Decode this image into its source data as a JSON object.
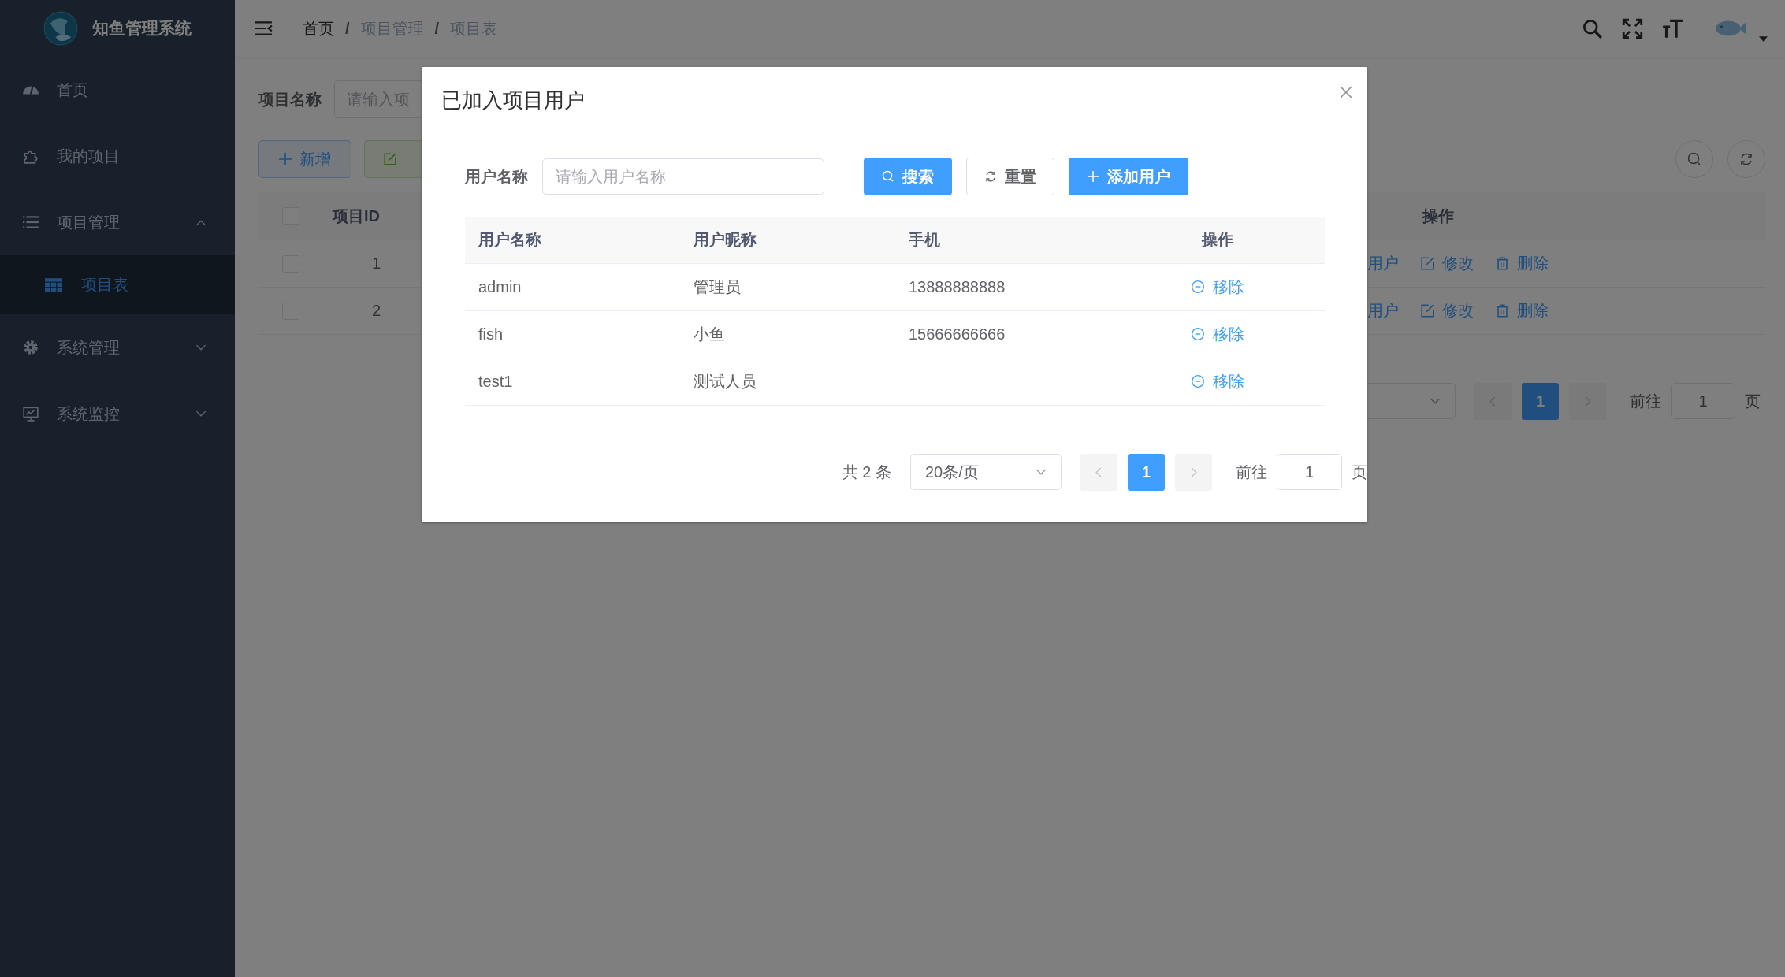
{
  "sidebar": {
    "title": "知鱼管理系统",
    "items": [
      {
        "label": "首页",
        "selected": false
      },
      {
        "label": "我的项目",
        "selected": false
      },
      {
        "label": "项目管理",
        "selected": false,
        "expanded": true,
        "children": [
          {
            "label": "项目表",
            "selected": true
          }
        ]
      },
      {
        "label": "系统管理",
        "selected": false,
        "expanded": false
      },
      {
        "label": "系统监控",
        "selected": false,
        "expanded": false
      }
    ]
  },
  "header": {
    "breadcrumb": [
      "首页",
      "项目管理",
      "项目表"
    ],
    "separator": "/"
  },
  "page": {
    "search_label": "项目名称",
    "search_placeholder": "请输入项",
    "add_button": "新增",
    "table": {
      "header_checked": false,
      "columns": [
        "项目ID",
        "操作"
      ],
      "rows": [
        {
          "id": "1",
          "checked": false,
          "actions": [
            {
              "kind": "text",
              "label": "用户"
            },
            {
              "kind": "edit",
              "label": "修改"
            },
            {
              "kind": "delete",
              "label": "删除"
            }
          ]
        },
        {
          "id": "2",
          "checked": false,
          "actions": [
            {
              "kind": "text",
              "label": "用户"
            },
            {
              "kind": "edit",
              "label": "修改"
            },
            {
              "kind": "delete",
              "label": "删除"
            }
          ]
        }
      ]
    },
    "pagination": {
      "pages": [
        {
          "label": "1",
          "selected": true
        }
      ],
      "goto_label": "前往",
      "goto_value": "1",
      "page_suffix": "页"
    }
  },
  "dialog": {
    "title": "已加入项目用户",
    "filter_label": "用户名称",
    "filter_placeholder": "请输入用户名称",
    "buttons": [
      {
        "label": "搜索",
        "kind": "search"
      },
      {
        "label": "重置",
        "kind": "reset"
      },
      {
        "label": "添加用户",
        "kind": "add"
      }
    ],
    "table": {
      "columns": [
        "用户名称",
        "用户昵称",
        "手机",
        "操作"
      ],
      "rows": [
        {
          "username": "admin",
          "nickname": "管理员",
          "phone": "13888888888",
          "action": "移除"
        },
        {
          "username": "fish",
          "nickname": "小鱼",
          "phone": "15666666666",
          "action": "移除"
        },
        {
          "username": "test1",
          "nickname": "测试人员",
          "action": "移除"
        }
      ]
    },
    "pagination": {
      "total": "共 2 条",
      "page_size": "20条/页",
      "pages": [
        {
          "label": "1",
          "selected": true
        }
      ],
      "goto_label": "前往",
      "goto_value": "1",
      "page_suffix": "页"
    }
  }
}
